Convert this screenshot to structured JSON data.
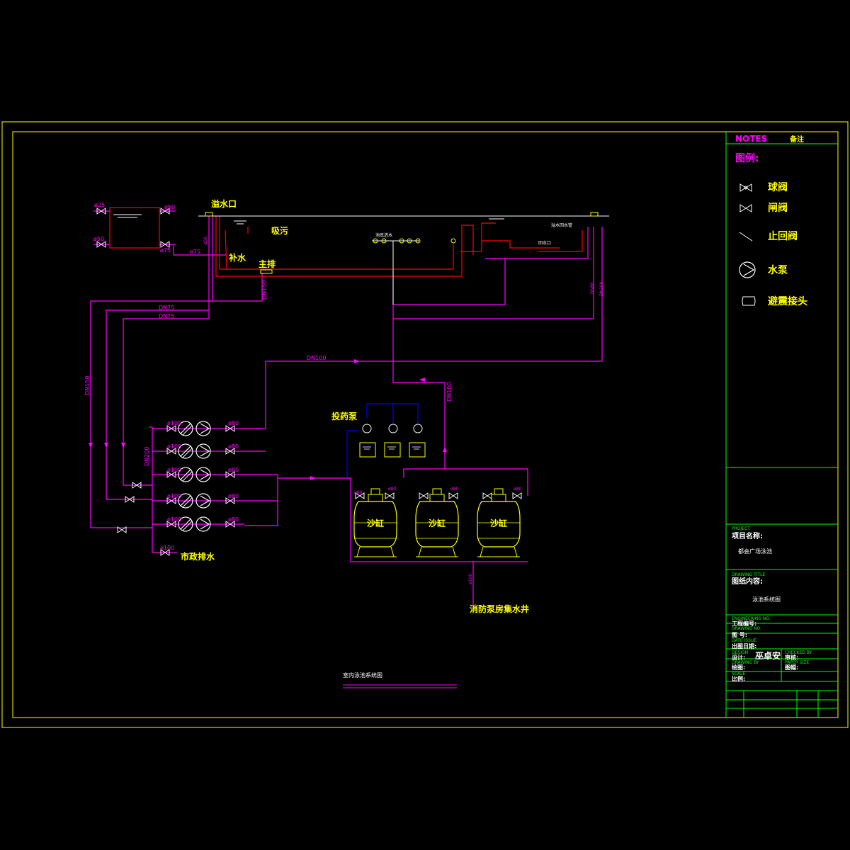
{
  "drawing": {
    "labels": {
      "overflow": "溢水口",
      "suction": "吸污",
      "makeup": "补水",
      "main_drain": "主排",
      "dosing_pump": "投药泵",
      "municipal_drain": "市政排水",
      "fire_pit": "消防泵房集水井",
      "sand_tank": "沙缸",
      "inlet_row": "池底进水",
      "return_outlet": "回水口",
      "overflow_gutter": "溢水回水管",
      "bottom_title": "室内泳池系统图"
    },
    "pipe_sizes": {
      "d25": "ø25",
      "d50": "ø50",
      "d75": "ø75",
      "d100": "ø100",
      "d80": "ø80",
      "DN75": "DN75",
      "DN150": "DN150",
      "DN100": "DN100",
      "DN200": "DN200",
      "DN80": "DN80"
    }
  },
  "legend": {
    "notes_header": "NOTES",
    "notes_cn": "备注",
    "title": "图例:",
    "items": [
      {
        "icon": "ball-valve-icon",
        "label": "球阀"
      },
      {
        "icon": "gate-valve-icon",
        "label": "闸阀"
      },
      {
        "icon": "check-valve-icon",
        "label": "止回阀"
      },
      {
        "icon": "pump-icon",
        "label": "水泵"
      },
      {
        "icon": "flex-joint-icon",
        "label": "避震接头"
      }
    ]
  },
  "title_block": {
    "project_en": "PROJECT",
    "project_cn": "项目名称:",
    "project_value": "都会广场泳池",
    "drawing_title_en": "DRAWING TITLE",
    "drawing_title_cn": "图纸内容:",
    "drawing_title_value": "泳池系统图",
    "eng_no_en": "ENGINEERING NO.",
    "eng_no_cn": "工程编号:",
    "dwg_no_en": "DRAWING NO.",
    "dwg_no_cn": "图 号:",
    "date_en": "DATE ISSUE",
    "date_cn": "出图日期:",
    "design_en": "DESIGN",
    "design_cn": "设计:",
    "designer": "巫卓安",
    "checked_en": "CHECKED BY",
    "checked_cn": "审核:",
    "drawn_en": "DRAWING BY",
    "drawn_cn": "绘图:",
    "paper_en": "PAPER SIZE",
    "paper_cn": "图幅:",
    "scale_en": "SCALE",
    "scale_cn": "比例:"
  },
  "colors": {
    "background": "#000000",
    "frame": "#ffff00",
    "pipe": "#ff00ff",
    "pipe_red": "#ff0000",
    "chem_line": "#0000ff",
    "equipment": "#ffff00",
    "title_block": "#00ff00",
    "text_white": "#ffffff"
  }
}
